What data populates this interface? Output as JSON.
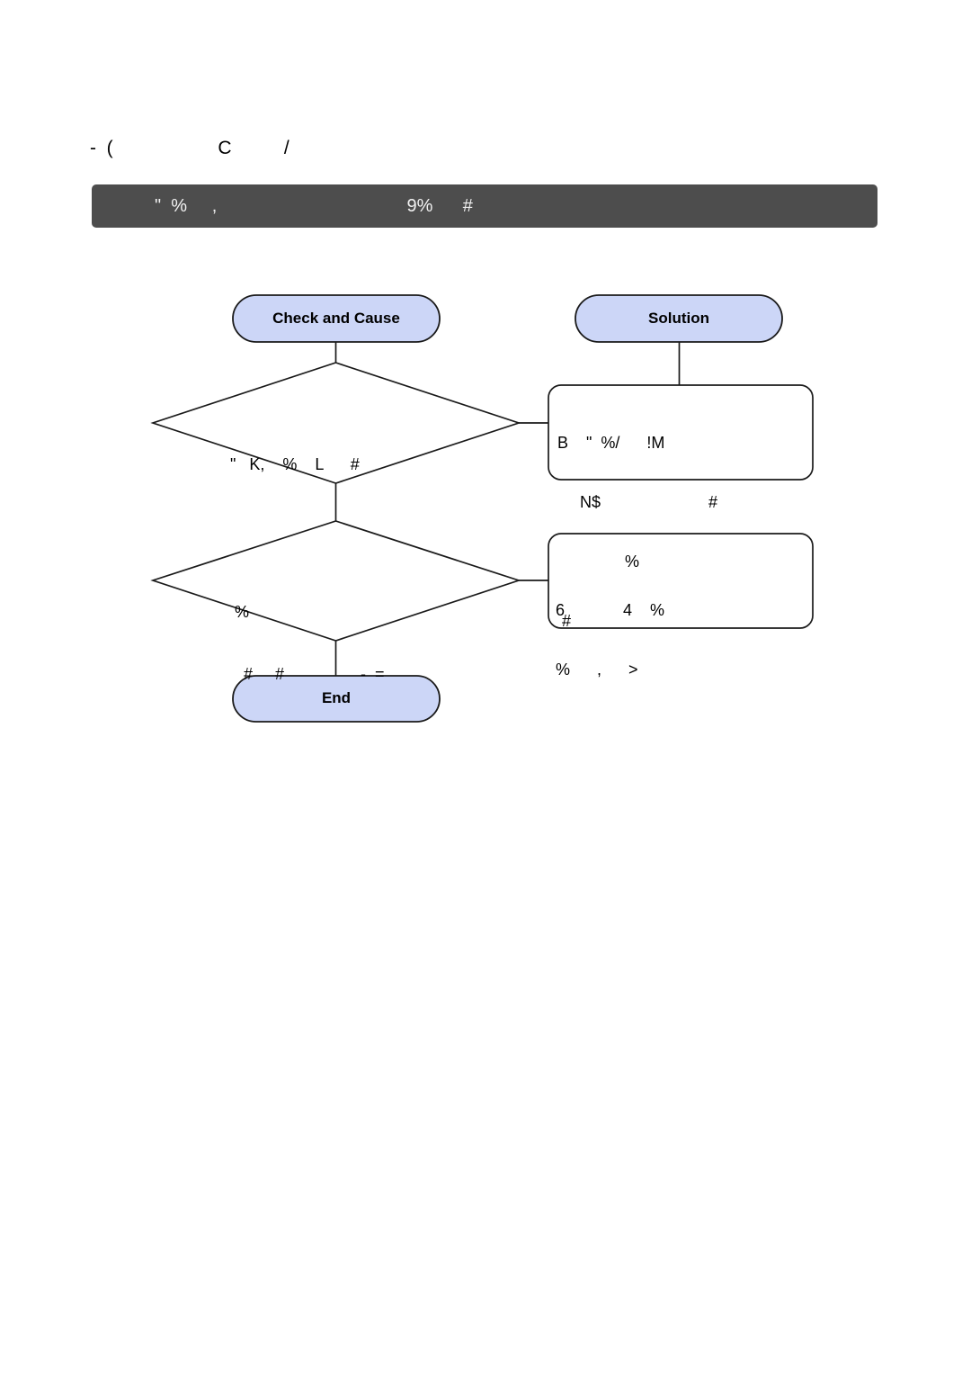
{
  "document": {
    "title_line": "-  (                    C          /"
  },
  "banner": {
    "text": "\"  %     ,                                      9%      #",
    "background_color": "#4d4d4d",
    "text_color": "#f2f2f2"
  },
  "flowchart": {
    "accent_fill": "#ccd6f7",
    "stroke_color": "#1a1a1a",
    "box_fill": "#ffffff",
    "nodes": {
      "start_check": {
        "label": "Check and Cause",
        "shape": "pill"
      },
      "start_solution": {
        "label": "Solution",
        "shape": "pill"
      },
      "decision_1": {
        "shape": "diamond",
        "lines": [
          "\"   K,    %    L      #"
        ]
      },
      "decision_2": {
        "shape": "diamond",
        "lines": [
          "   %",
          "     #     #                 -  ="
        ]
      },
      "solution_1": {
        "shape": "rounded-rect",
        "lines": [
          "B    \"  %/      !M",
          "     N$                        #",
          "               %",
          " #"
        ]
      },
      "solution_2": {
        "shape": "rounded-rect",
        "lines": [
          "6             4    %",
          "%      ,      >"
        ]
      },
      "end": {
        "label": "End",
        "shape": "pill"
      }
    }
  }
}
